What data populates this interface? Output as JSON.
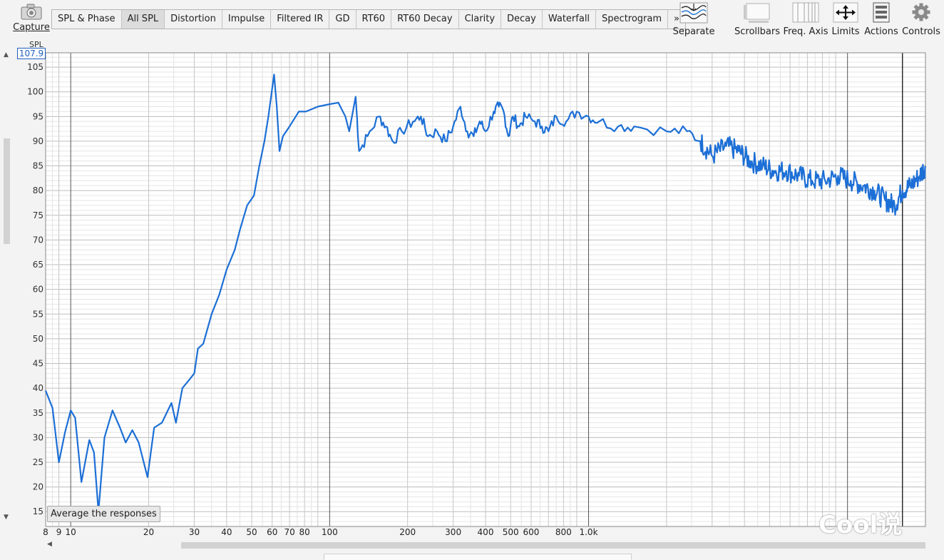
{
  "toolbar": {
    "capture_label": "Capture",
    "tabs": [
      {
        "label": "SPL & Phase",
        "active": false
      },
      {
        "label": "All SPL",
        "active": true
      },
      {
        "label": "Distortion",
        "active": false
      },
      {
        "label": "Impulse",
        "active": false
      },
      {
        "label": "Filtered IR",
        "active": false
      },
      {
        "label": "GD",
        "active": false
      },
      {
        "label": "RT60",
        "active": false
      },
      {
        "label": "RT60 Decay",
        "active": false
      },
      {
        "label": "Clarity",
        "active": false
      },
      {
        "label": "Decay",
        "active": false
      },
      {
        "label": "Waterfall",
        "active": false
      },
      {
        "label": "Spectrogram",
        "active": false
      },
      {
        "label": "»",
        "active": false
      }
    ],
    "separate_label": "Separate",
    "scrollbars_label": "Scrollbars",
    "freq_axis_label": "Freq. Axis",
    "limits_label": "Limits",
    "actions_label": "Actions",
    "controls_label": "Controls"
  },
  "y_readout": {
    "label": "SPL",
    "value": "107.9"
  },
  "average_button_label": "Average the responses",
  "watermark_text": "Cool说",
  "colors": {
    "trace": "#1c6fd6",
    "grid_major": "#555555",
    "grid_minor": "#c8c8c8",
    "background": "#ffffff"
  },
  "chart_data": {
    "type": "line",
    "x_scale": "log",
    "xlim": [
      8,
      20000
    ],
    "ylim": [
      12,
      107.9
    ],
    "y_ticks": [
      15,
      20,
      25,
      30,
      35,
      40,
      45,
      50,
      55,
      60,
      65,
      70,
      75,
      80,
      85,
      90,
      95,
      100,
      105
    ],
    "x_tick_labels": [
      {
        "v": 8,
        "t": "8"
      },
      {
        "v": 9,
        "t": "9"
      },
      {
        "v": 10,
        "t": "10"
      },
      {
        "v": 20,
        "t": "20"
      },
      {
        "v": 30,
        "t": "30"
      },
      {
        "v": 40,
        "t": "40"
      },
      {
        "v": 50,
        "t": "50"
      },
      {
        "v": 60,
        "t": "60"
      },
      {
        "v": 70,
        "t": "70"
      },
      {
        "v": 80,
        "t": "80"
      },
      {
        "v": 100,
        "t": "100"
      },
      {
        "v": 200,
        "t": "200"
      },
      {
        "v": 300,
        "t": "300"
      },
      {
        "v": 400,
        "t": "400"
      },
      {
        "v": 500,
        "t": "500"
      },
      {
        "v": 600,
        "t": "600"
      },
      {
        "v": 800,
        "t": "800"
      },
      {
        "v": 1000,
        "t": "1.0k"
      }
    ],
    "cursor_x": 16300,
    "series": [
      {
        "points": [
          [
            8,
            39.5
          ],
          [
            8.5,
            36
          ],
          [
            9,
            25
          ],
          [
            9.5,
            31
          ],
          [
            10,
            35.5
          ],
          [
            10.4,
            34
          ],
          [
            11,
            21
          ],
          [
            11.8,
            29.5
          ],
          [
            12.3,
            27
          ],
          [
            12.8,
            15
          ],
          [
            13.5,
            30
          ],
          [
            14.5,
            35.5
          ],
          [
            15.5,
            32
          ],
          [
            16.3,
            29
          ],
          [
            17.3,
            31.5
          ],
          [
            18.3,
            29
          ],
          [
            19.8,
            22
          ],
          [
            21,
            32
          ],
          [
            22.5,
            33
          ],
          [
            24.5,
            37
          ],
          [
            25.5,
            33
          ],
          [
            27,
            40
          ],
          [
            28.5,
            41.5
          ],
          [
            30,
            43
          ],
          [
            31,
            48
          ],
          [
            32.5,
            49
          ],
          [
            35,
            55
          ],
          [
            37.5,
            59
          ],
          [
            40,
            64
          ],
          [
            43,
            68
          ],
          [
            45,
            72
          ],
          [
            48,
            77
          ],
          [
            51,
            79
          ],
          [
            53.5,
            85
          ],
          [
            56,
            90
          ],
          [
            58,
            95
          ],
          [
            61,
            103.5
          ],
          [
            62.5,
            97
          ],
          [
            64,
            88
          ],
          [
            66,
            91
          ],
          [
            70,
            93
          ],
          [
            76,
            96
          ],
          [
            81,
            96
          ],
          [
            90,
            97
          ],
          [
            100,
            97.5
          ],
          [
            108,
            97.8
          ],
          [
            115,
            95
          ],
          [
            119,
            92
          ],
          [
            126,
            99
          ],
          [
            130,
            88
          ],
          [
            140,
            91
          ],
          [
            155,
            95
          ],
          [
            165,
            93
          ],
          [
            175,
            90
          ],
          [
            190,
            92
          ],
          [
            210,
            94
          ],
          [
            225,
            95
          ],
          [
            240,
            91
          ],
          [
            260,
            92
          ],
          [
            280,
            90
          ],
          [
            300,
            93
          ],
          [
            320,
            97
          ],
          [
            340,
            92
          ],
          [
            360,
            91
          ],
          [
            380,
            94
          ],
          [
            400,
            92
          ],
          [
            430,
            96
          ],
          [
            450,
            97
          ],
          [
            470,
            96
          ],
          [
            490,
            91
          ],
          [
            510,
            95
          ],
          [
            540,
            93
          ],
          [
            570,
            95
          ],
          [
            620,
            94
          ],
          [
            660,
            93
          ],
          [
            700,
            92
          ],
          [
            750,
            95
          ],
          [
            820,
            94
          ],
          [
            900,
            96
          ],
          [
            1000,
            95
          ],
          [
            1100,
            94
          ],
          [
            1300,
            93
          ],
          [
            1500,
            93
          ],
          [
            2000,
            92
          ],
          [
            2400,
            92
          ],
          [
            2700,
            90
          ],
          [
            3000,
            87
          ],
          [
            3400,
            89
          ],
          [
            3800,
            88
          ],
          [
            4200,
            86
          ],
          [
            4700,
            85
          ],
          [
            5200,
            84
          ],
          [
            5800,
            84
          ],
          [
            6500,
            83
          ],
          [
            7300,
            82
          ],
          [
            8200,
            82
          ],
          [
            9200,
            83
          ],
          [
            10300,
            82
          ],
          [
            11500,
            81
          ],
          [
            12700,
            80
          ],
          [
            14000,
            78
          ],
          [
            15200,
            77
          ],
          [
            16300,
            80
          ],
          [
            17500,
            81
          ],
          [
            19000,
            83
          ],
          [
            20000,
            85
          ]
        ]
      }
    ]
  }
}
